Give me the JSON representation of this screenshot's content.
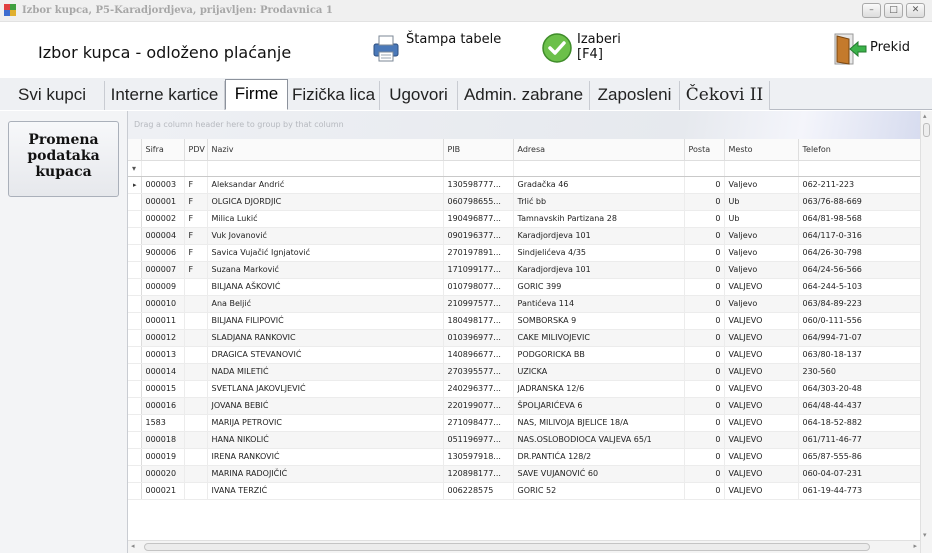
{
  "window": {
    "title": "Izbor kupca, P5-Karadjordjeva, prijavljen: Prodavnica 1",
    "buttons": [
      "–",
      "□",
      "✕"
    ]
  },
  "toolbar": {
    "title": "Izbor kupca - odloženo plaćanje",
    "print_label": "Štampa tabele",
    "select_label": "Izaberi",
    "select_shortcut": "[F4]",
    "cancel_label": "Prekid"
  },
  "tabs": [
    {
      "label": "Svi kupci"
    },
    {
      "label": "Interne kartice"
    },
    {
      "label": "Firme"
    },
    {
      "label": "Fizička lica"
    },
    {
      "label": "Ugovori"
    },
    {
      "label": "Admin. zabrane"
    },
    {
      "label": "Zaposleni"
    },
    {
      "label": "Čekovi II"
    }
  ],
  "active_tab": "Firme",
  "left_panel": {
    "button_label": "Promena\npodataka\nkupaca"
  },
  "grid": {
    "group_hint": "Drag a column header here to group by that column",
    "filter_icon": "▾",
    "row_indicator": "▸",
    "columns": [
      "Sifra",
      "PDV",
      "Naziv",
      "PIB",
      "Adresa",
      "Posta",
      "Mesto",
      "Telefon"
    ],
    "rows": [
      [
        "000003",
        "F",
        "Aleksandar Andrić",
        "130598777...",
        "Gradačka 46",
        "0",
        "Valjevo",
        "062-211-223"
      ],
      [
        "000001",
        "F",
        "OLGICA DJORDJIC",
        "060798655...",
        "Trlić bb",
        "0",
        "Ub",
        "063/76-88-669"
      ],
      [
        "000002",
        "F",
        "Milica Lukić",
        "190496877...",
        "Tamnavskih Partizana 28",
        "0",
        "Ub",
        "064/81-98-568"
      ],
      [
        "000004",
        "F",
        "Vuk Jovanović",
        "090196377...",
        "Karadjordjeva 101",
        "0",
        "Valjevo",
        "064/117-0-316"
      ],
      [
        "900006",
        "F",
        "Savica Vujačić Ignjatović",
        "270197891...",
        "Sindjelićeva 4/35",
        "0",
        "Valjevo",
        "064/26-30-798"
      ],
      [
        "000007",
        "F",
        "Suzana Marković",
        "171099177...",
        "Karadjordjeva 101",
        "0",
        "Valjevo",
        "064/24-56-566"
      ],
      [
        "000009",
        "",
        "BILJANA AŠKOVIĆ",
        "010798077...",
        "GORIC 399",
        "0",
        "VALJEVO",
        "064-244-5-103"
      ],
      [
        "000010",
        "",
        "Ana Beljić",
        "210997577...",
        "Pantićeva 114",
        "0",
        "Valjevo",
        "063/84-89-223"
      ],
      [
        "000011",
        "",
        "BILJANA FILIPOVIĆ",
        "180498177...",
        "SOMBORSKA 9",
        "0",
        "VALJEVO",
        "060/0-111-556"
      ],
      [
        "000012",
        "",
        "SLADJANA RANKOVIC",
        "010396977...",
        "CAKE MILIVOJEVIC",
        "0",
        "VALJEVO",
        "064/994-71-07"
      ],
      [
        "000013",
        "",
        "DRAGICA STEVANOVIĆ",
        "140896677...",
        "PODGORICKA BB",
        "0",
        "VALJEVO",
        "063/80-18-137"
      ],
      [
        "000014",
        "",
        "NADA MILETIĆ",
        "270395577...",
        "UZICKA",
        "0",
        "VALJEVO",
        "230-560"
      ],
      [
        "000015",
        "",
        "SVETLANA JAKOVLJEVIĆ",
        "240296377...",
        "JADRANSKA 12/6",
        "0",
        "VALJEVO",
        "064/303-20-48"
      ],
      [
        "000016",
        "",
        "JOVANA BEBIĆ",
        "220199077...",
        "ŠPOLJARIĆEVA 6",
        "0",
        "VALJEVO",
        "064/48-44-437"
      ],
      [
        "1583",
        "",
        "MARIJA PETROVIC",
        "271098477...",
        "NAS, MILIVOJA BJELICE 18/A",
        "0",
        "VALJEVO",
        "064-18-52-882"
      ],
      [
        "000018",
        "",
        "HANA NIKOLIĆ",
        "051196977...",
        "NAS.OSLOBODIOCA VALJEVA 65/1",
        "0",
        "VALJEVO",
        "061/711-46-77"
      ],
      [
        "000019",
        "",
        "IRENA RANKOVIĆ",
        "130597918...",
        "DR.PANTIĆA  128/2",
        "0",
        "VALJEVO",
        "065/87-555-86"
      ],
      [
        "000020",
        "",
        "MARINA RADOJIČIĆ",
        "120898177...",
        "SAVE VUJANOVIĆ 60",
        "0",
        "VALJEVO",
        "060-04-07-231"
      ],
      [
        "000021",
        "",
        "IVANA TERZIĆ",
        "006228575",
        "GORIC  52",
        "0",
        "VALJEVO",
        "061-19-44-773"
      ]
    ]
  },
  "colors": {
    "print_icon": "#4a78b8",
    "select_icon": "#6cc04a",
    "cancel_arrow": "#3bb24a",
    "door": "#c47a2c"
  }
}
